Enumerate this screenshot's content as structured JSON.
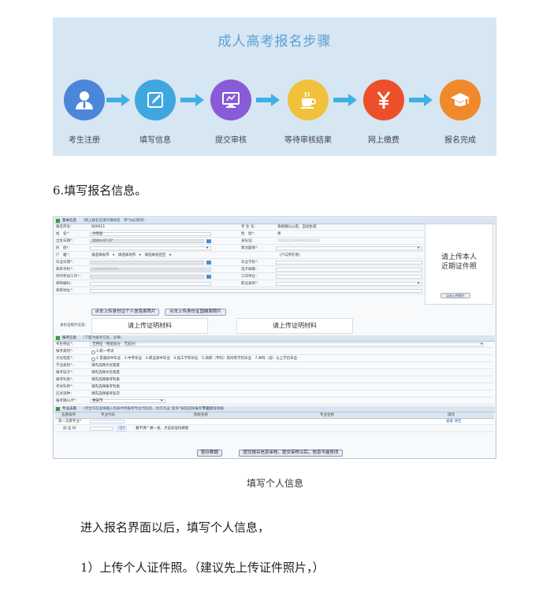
{
  "banner": {
    "title": "成人高考报名步骤",
    "steps": [
      {
        "label": "考生注册",
        "icon": "user-icon",
        "color": "#4c86d9"
      },
      {
        "label": "填写信息",
        "icon": "edit-icon",
        "color": "#3fa6e0"
      },
      {
        "label": "提交审核",
        "icon": "monitor-icon",
        "color": "#8a5bd6"
      },
      {
        "label": "等待审核结果",
        "icon": "coffee-icon",
        "color": "#f1c13c"
      },
      {
        "label": "网上缴费",
        "icon": "yen-icon",
        "color": "#ec4f2a"
      },
      {
        "label": "报名完成",
        "icon": "graduation-cap-icon",
        "color": "#f0892c"
      }
    ],
    "arrow_color": "#3fb0e6"
  },
  "heading": "6.填写报名信息。",
  "form": {
    "basic_section": {
      "title": "基本信息",
      "note": "（网上报名前请仔细阅读　带*为必填项）"
    },
    "rows": [
      {
        "l1": "报名序号：",
        "v1": "600011",
        "l2": "考 生 号：",
        "v2": "系统确认以后，自动生成"
      },
      {
        "l1": "姓　名*：",
        "v1": "孙晓丽",
        "l2": "性　别*：",
        "v2": "男"
      },
      {
        "l1": "出生日期*：",
        "v1": "2004-07-27",
        "l2": "身份证：",
        "v2": "3506221999XXXXXXXX"
      },
      {
        "l1": "民　族*：",
        "v1": "",
        "l2": "政治面貌*：",
        "v2": ""
      },
      {
        "l1": "户　籍*：",
        "v1": "请选择省市　▾　请选择地市　▾　请选择县区区　▾",
        "l2": "",
        "v2": "（户口所在地）"
      },
      {
        "l1": "毕业日期*：",
        "v1": "",
        "l2": "毕业学校*：",
        "v2": ""
      },
      {
        "l1": "联系手机*：",
        "v1": "138XXXXXXXX",
        "l2": "电子邮箱：",
        "v2": ""
      },
      {
        "l1": "何时参加工作*：",
        "v1": "",
        "l2": "工作单位：",
        "v2": ""
      },
      {
        "l1": "邮政编码：",
        "v1": "",
        "l2": "职业类别*：",
        "v2": ""
      },
      {
        "l1": "邮寄地址*：",
        "v1": "",
        "l2": "",
        "v2": ""
      }
    ],
    "photo_text_1": "请上传本人",
    "photo_text_2": "近期证件照",
    "photo_button": "点击上传照片",
    "upload_front_button": "点击上传身份证个人信息面照片",
    "upload_back_button": "点击上传身份证国徽面照片",
    "id_photo_label": "身份证照片信息：",
    "doc_box_text": "请上传证明材料",
    "apply_section": {
      "title": "报考信息",
      "note": "（下面为报考信息，必填）"
    },
    "apply_rows": [
      {
        "l": "考生特征*：",
        "v": "无特征（物层加分：无加分）"
      },
      {
        "l": "报考类别*：",
        "v": "1.统一考试"
      },
      {
        "l": "文化程度*：",
        "v": "1.普通高中毕业　2.中专毕业　3.职业高中毕业　4.技工学校毕业　5.高职（专科）及同等学历毕业　7.本科（含）以上学历毕业"
      },
      {
        "l": "学业类别*：",
        "v": "请先选择文化程度"
      },
      {
        "l": "报考层次*：",
        "v": "请先选择文化程度"
      },
      {
        "l": "报考科类*：",
        "v": "请先选择报考科类"
      },
      {
        "l": "考试科目*：",
        "v": "请先选择报考科类"
      },
      {
        "l": "应试语种：",
        "v": "请先选择报考层次"
      },
      {
        "l": "报考确认点*：",
        "v": "惠安市"
      }
    ],
    "major_section": {
      "title": "专业志愿",
      "note": "（考生可在选择输入列表中所报考专业代码后，也可点击“查询”按钮选择报考专业）",
      "warn": "不能重复填报"
    },
    "table_headers": [
      "志愿排序",
      "专业代码",
      "院校名称",
      "专业名称",
      "操作"
    ],
    "table_row_1": {
      "order": "第一志愿专业*",
      "op": "查看 清空"
    },
    "verify_label": "验 证 码",
    "verify_code": "宁7",
    "verify_hint": "看不清？换一张，点击验证码刷新",
    "save_button": "暂存数据",
    "submit_button": "提交报名信息审核。提交审核以后，信息不能修改"
  },
  "caption": "填写个人信息",
  "para1": "进入报名界面以后，填写个人信息，",
  "para2": "1）上传个人证件照。（建议先上传证件照片，）"
}
